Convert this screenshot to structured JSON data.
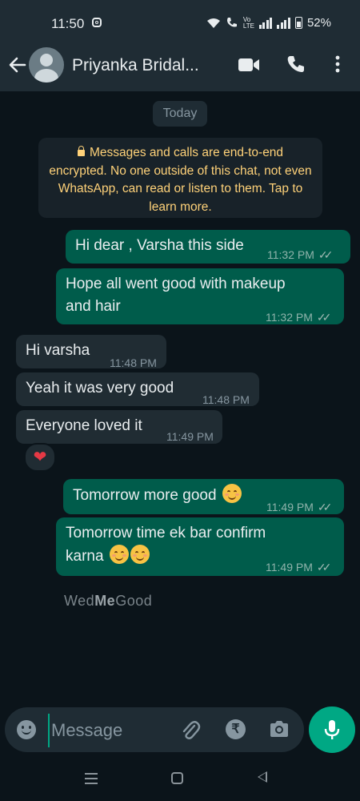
{
  "status_bar": {
    "time": "11:50",
    "battery": "52%"
  },
  "header": {
    "contact_name": "Priyanka Bridal..."
  },
  "chat": {
    "date_chip": "Today",
    "encryption_notice": "Messages and calls are end-to-end encrypted. No one outside of this chat, not even WhatsApp, can read or listen to them. Tap to learn more.",
    "messages": [
      {
        "direction": "outgoing",
        "text": "Hi dear , Varsha this side",
        "time": "11:32 PM",
        "status": "read"
      },
      {
        "direction": "outgoing",
        "text_line1": "Hope all went good with makeup",
        "text_line2": "and hair",
        "time": "11:32 PM",
        "status": "read"
      },
      {
        "direction": "incoming",
        "text": "Hi varsha",
        "time": "11:48 PM"
      },
      {
        "direction": "incoming",
        "text": "Yeah it was very good",
        "time": "11:48 PM"
      },
      {
        "direction": "incoming",
        "text": "Everyone loved it",
        "time": "11:49 PM",
        "reaction": "❤"
      },
      {
        "direction": "outgoing",
        "text": "Tomorrow more good",
        "emoji": "smiling-face-with-smiling-eyes",
        "time": "11:49 PM",
        "status": "read"
      },
      {
        "direction": "outgoing",
        "text_line1": "Tomorrow time ek bar confirm",
        "text_line2": "karna",
        "emoji": "smiling-face-with-smiling-eyes x2",
        "time": "11:49 PM",
        "status": "read"
      }
    ],
    "watermark_light": "Wed",
    "watermark_bold": "Me",
    "watermark_end": "Good"
  },
  "composer": {
    "placeholder": "Message"
  },
  "colors": {
    "outgoing_bubble": "#005c4b",
    "incoming_bubble": "#202c33",
    "accent": "#00a884",
    "notice_text": "#ffd279"
  }
}
